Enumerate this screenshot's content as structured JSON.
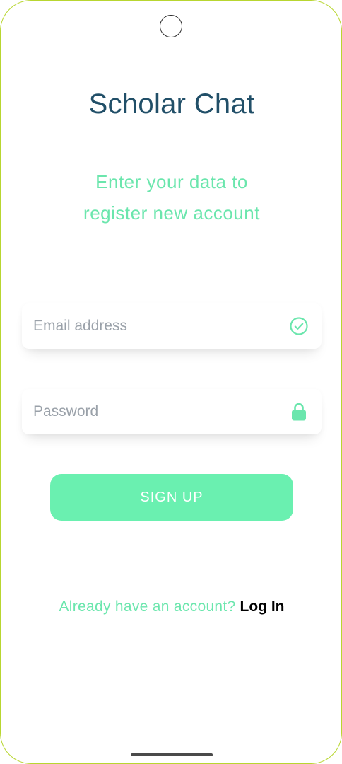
{
  "app": {
    "title": "Scholar Chat",
    "subtitle_line1": "Enter your data to",
    "subtitle_line2": "register new account"
  },
  "form": {
    "email": {
      "placeholder": "Email address",
      "value": "",
      "icon": "check-circle-icon"
    },
    "password": {
      "placeholder": "Password",
      "value": "",
      "icon": "lock-icon"
    },
    "submit_label": "SIGN UP"
  },
  "footer": {
    "prompt": "Already have an account?",
    "link_label": "Log In"
  },
  "colors": {
    "accent": "#6af0b0",
    "title": "#214f68",
    "subtitle": "#6be6ad",
    "frame": "#b8d630"
  }
}
